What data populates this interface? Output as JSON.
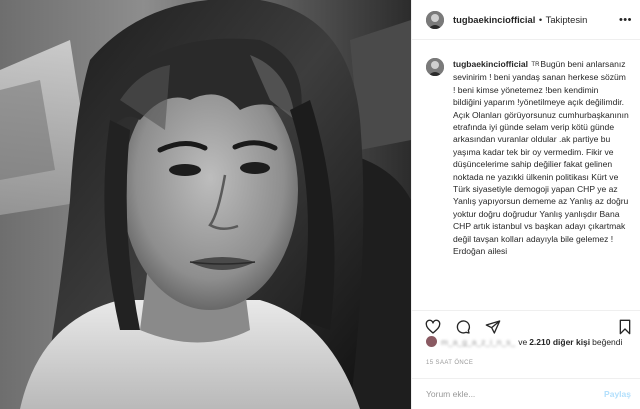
{
  "header": {
    "username": "tugbaekinciofficial",
    "separator": "•",
    "follow_status": "Takiptesin",
    "more_icon": "more-horizontal-icon"
  },
  "caption": {
    "username": "tugbaekinciofficial",
    "flag": "TR",
    "text": "Bugün beni anlarsanız sevinirim ! beni yandaş sanan herkese sözüm ! beni kimse yönetemez !ben kendimin bildiğini yaparım !yönetilmeye açık değilimdir. Açık Olanları görüyorsunuz cumhurbaşkanının etrafında iyi günde selam verip kötü günde arkasından vuranlar oldular .ak partiye bu yaşıma kadar tek bir oy vermedim. Fikir ve düşüncelerime sahip değilier fakat gelinen noktada ne yazıkki ülkenin politikası Kürt ve Türk siyasetiyle demogoji yapan CHP ye az Yanlış yapıyorsun dememe az Yanlış az doğru yoktur doğru doğrudur Yanlış yanlışdır Bana CHP artık istanbul vs başkan adayı çıkartmak değil tavşan kolları adayıyla bile gelemez ! Erdoğan ailesi"
  },
  "actions": {
    "like_icon": "heart-icon",
    "comment_icon": "comment-icon",
    "share_icon": "share-icon",
    "save_icon": "bookmark-icon"
  },
  "likes": {
    "blurred_user": "m_a_g_a_z_i_n_s_",
    "connector": "ve",
    "count": "2.210 diğer kişi",
    "suffix": "beğendi"
  },
  "timestamp": "15 SAAT ÖNCE",
  "comment_box": {
    "placeholder": "Yorum ekle...",
    "post_label": "Paylaş"
  },
  "colors": {
    "text": "#262626",
    "muted": "#999999",
    "border": "#efefef",
    "post_button_disabled": "#b2dffc"
  }
}
